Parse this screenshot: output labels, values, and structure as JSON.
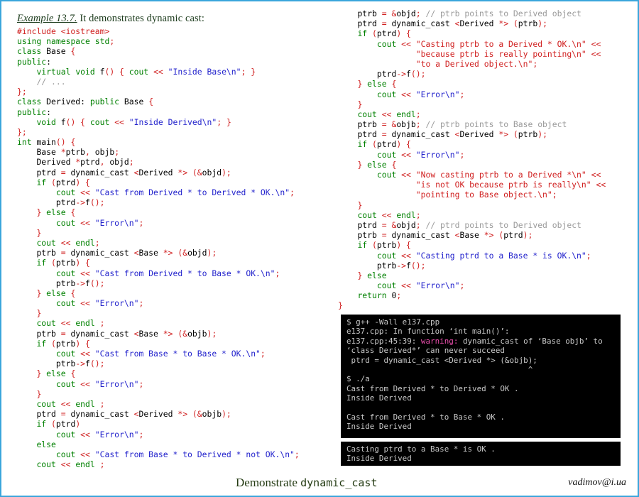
{
  "slide": {
    "border_color": "#3aa5dc",
    "background": "#ffffff"
  },
  "heading": {
    "label": "Example 13.7.",
    "text": " It demonstrates dynamic cast:"
  },
  "colors": {
    "keyword": "#008000",
    "punctuation": "#d02020",
    "string": "#2222cc",
    "string_alt": "#d02020",
    "comment": "#9a9a9a",
    "terminal_bg": "#000000",
    "terminal_fg": "#c8c8c8",
    "terminal_warning": "#ef4fb0",
    "footer_title": "#243b13"
  },
  "left_code": [
    "#include <iostream>",
    "using namespace std;",
    "class Base {",
    "public:",
    "    virtual void f() { cout << \"Inside Base\\n\"; }",
    "    // ...",
    "};",
    "class Derived: public Base {",
    "public:",
    "    void f() { cout << \"Inside Derived\\n\"; }",
    "};",
    "int main() {",
    "    Base *ptrb, objb;",
    "    Derived *ptrd, objd;",
    "    ptrd = dynamic_cast <Derived *> (&objd);",
    "    if (ptrd) {",
    "        cout << \"Cast from Derived * to Derived * OK.\\n\";",
    "        ptrd->f();",
    "    } else {",
    "        cout << \"Error\\n\";",
    "    }",
    "    cout << endl;",
    "    ptrb = dynamic_cast <Base *> (&objd);",
    "    if (ptrb) {",
    "        cout << \"Cast from Derived * to Base * OK.\\n\";",
    "        ptrb->f();",
    "    } else {",
    "        cout << \"Error\\n\";",
    "    }",
    "    cout << endl ;",
    "    ptrb = dynamic_cast <Base *> (&objb);",
    "    if (ptrb) {",
    "        cout << \"Cast from Base * to Base * OK.\\n\";",
    "        ptrb->f();",
    "    } else {",
    "        cout << \"Error\\n\";",
    "    }",
    "    cout << endl ;",
    "    ptrd = dynamic_cast <Derived *> (&objb);",
    "    if (ptrd)",
    "        cout << \"Error\\n\";",
    "    else",
    "        cout << \"Cast from Base * to Derived * not OK.\\n\";",
    "    cout << endl ;"
  ],
  "right_code": [
    "    ptrb = &objd; // ptrb points to Derived object",
    "    ptrd = dynamic_cast <Derived *> (ptrb);",
    "    if (ptrd) {",
    "        cout << \"Casting ptrb to a Derived * OK.\\n\" <<",
    "                \"because ptrb is really pointing\\n\" <<",
    "                \"to a Derived object.\\n\";",
    "        ptrd->f();",
    "    } else {",
    "        cout << \"Error\\n\";",
    "    }",
    "    cout << endl;",
    "    ptrb = &objb; // ptrb points to Base object",
    "    ptrd = dynamic_cast <Derived *> (ptrb);",
    "    if (ptrd) {",
    "        cout << \"Error\\n\";",
    "    } else {",
    "        cout << \"Now casting ptrb to a Derived *\\n\" <<",
    "                \"is not OK because ptrb is really\\n\" <<",
    "                \"pointing to Base object.\\n\";",
    "    }",
    "    cout << endl;",
    "    ptrd = &objd; // ptrd points to Derived object",
    "    ptrb = dynamic_cast <Base *> (ptrd);",
    "    if (ptrb) {",
    "        cout << \"Casting ptrd to a Base * is OK.\\n\";",
    "        ptrb->f();",
    "    } else",
    "        cout << \"Error\\n\";",
    "    return 0;",
    "}"
  ],
  "terminal_1": {
    "lines": [
      "$ g++ -Wall e137.cpp",
      "e137.cpp: In function ‘int main()’:",
      "e137.cpp:45:39: warning: dynamic_cast of ‘Base objb’ to",
      "‘class Derived*’ can never succeed",
      " ptrd = dynamic_cast <Derived *> (&objb);",
      "                                       ^",
      "$ ./a",
      "Cast from Derived * to Derived * OK .",
      "Inside Derived",
      "",
      "Cast from Derived * to Base * OK .",
      "Inside Derived"
    ],
    "warning_word": "warning:"
  },
  "terminal_2": {
    "lines": [
      "Casting ptrd to a Base * is OK .",
      "Inside Derived"
    ]
  },
  "footer": {
    "title_prefix": "Demonstrate ",
    "title_mono": "dynamic_cast",
    "email": "vadimov@i.ua"
  }
}
